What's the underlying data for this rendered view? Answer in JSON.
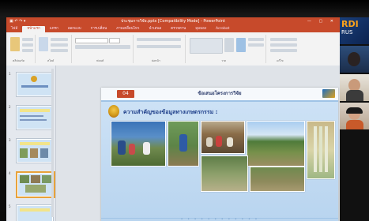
{
  "window": {
    "title": "ประชุมการวิจัย.pptx [Compatibility Mode] - PowerPoint",
    "window_controls": "— ▢ ✕"
  },
  "ribbon_tabs": [
    "ไฟล์",
    "หน้าแรก",
    "แทรก",
    "ออกแบบ",
    "การเปลี่ยน",
    "ภาพเคลื่อนไหว",
    "นำเสนอ",
    "ตรวจทาน",
    "มุมมอง",
    "Acrobat"
  ],
  "active_tab_index": 1,
  "ribbon": {
    "groups": [
      "คลิปบอร์ด",
      "สไลด์",
      "ฟอนต์",
      "ย่อหน้า",
      "วาด",
      "แก้ไข"
    ]
  },
  "thumbnails": [
    {
      "number": "1"
    },
    {
      "number": "2"
    },
    {
      "number": "3"
    },
    {
      "number": "4"
    },
    {
      "number": "5"
    }
  ],
  "slide": {
    "number_badge": "04",
    "header_title": "ข้อเสนอโครงการวิจัย",
    "subheading": "ความสำคัญของข้อมูลทางเกษตรกรรม :",
    "logo_text": "TV"
  },
  "video_panel": {
    "brand": "RDI",
    "brand_sub": "RUS"
  },
  "colors": {
    "ribbon_accent": "#c74a2b",
    "slide_bg": "#cfe3f6",
    "subheading": "#1f3f8a"
  }
}
